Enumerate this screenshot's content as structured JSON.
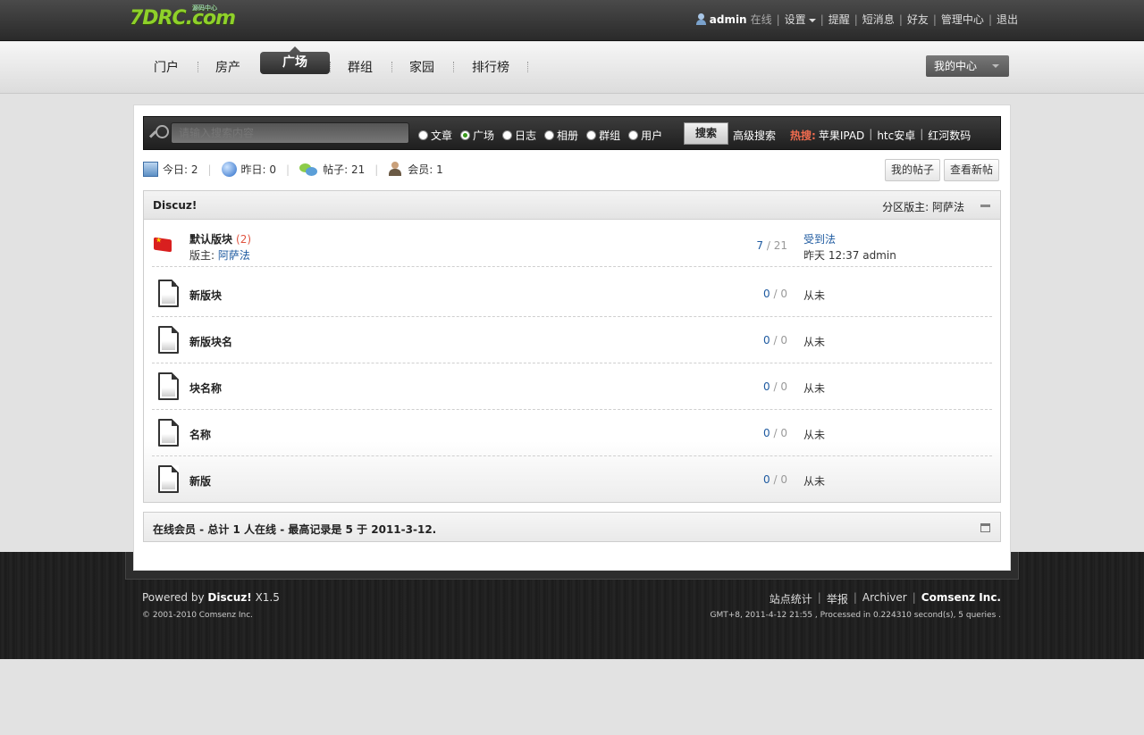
{
  "header": {
    "logo_text": "7DRC.com",
    "logo_small": "源码中心",
    "user_name": "admin",
    "user_status": "在线",
    "links": [
      "设置",
      "提醒",
      "短消息",
      "好友",
      "管理中心",
      "退出"
    ]
  },
  "nav": {
    "items": [
      "门户",
      "房产",
      "广场",
      "群组",
      "家园",
      "排行榜"
    ],
    "active": "广场",
    "my_center": "我的中心"
  },
  "search": {
    "placeholder": "请输入搜索内容",
    "types": [
      "文章",
      "广场",
      "日志",
      "相册",
      "群组",
      "用户"
    ],
    "selected_type": "广场",
    "button": "搜索",
    "advanced": "高级搜索",
    "hot_label": "热搜:",
    "hot_terms": [
      "苹果IPAD",
      "htc安卓",
      "红河数码"
    ]
  },
  "stats": {
    "today": "今日: 2",
    "yesterday": "昨日: 0",
    "posts": "帖子: 21",
    "members": "会员: 1",
    "my_posts_button": "我的帖子",
    "new_posts_button": "查看新帖"
  },
  "forum": {
    "category": "Discuz!",
    "moderator_label": "分区版主: 阿萨法",
    "rows": [
      {
        "name": "默认版块",
        "count": "(2)",
        "mod_label": "版主:",
        "mod_name": "阿萨法",
        "topics": "7",
        "sep": "/",
        "posts": "21",
        "last_title": "受到法",
        "last_info": "昨天 12:37 admin"
      },
      {
        "name": "新版块",
        "topics": "0",
        "sep": "/",
        "posts": "0",
        "last_info": "从未"
      },
      {
        "name": "新版块名",
        "topics": "0",
        "sep": "/",
        "posts": "0",
        "last_info": "从未"
      },
      {
        "name": "块名称",
        "topics": "0",
        "sep": "/",
        "posts": "0",
        "last_info": "从未"
      },
      {
        "name": "名称",
        "topics": "0",
        "sep": "/",
        "posts": "0",
        "last_info": "从未"
      },
      {
        "name": "新版",
        "topics": "0",
        "sep": "/",
        "posts": "0",
        "last_info": "从未"
      }
    ]
  },
  "online": {
    "text": "在线会员 - 总计 1 人在线 - 最高记录是 5 于 2011-3-12."
  },
  "footer": {
    "powered_prefix": "Powered by",
    "powered_brand": "Discuz!",
    "powered_version": "X1.5",
    "copyright": "© 2001-2010 Comsenz Inc.",
    "links": [
      "站点统计",
      "举报",
      "Archiver"
    ],
    "company": "Comsenz Inc.",
    "gmt": "GMT+8, 2011-4-12 21:55 , Processed in 0.224310 second(s), 5 queries ."
  }
}
